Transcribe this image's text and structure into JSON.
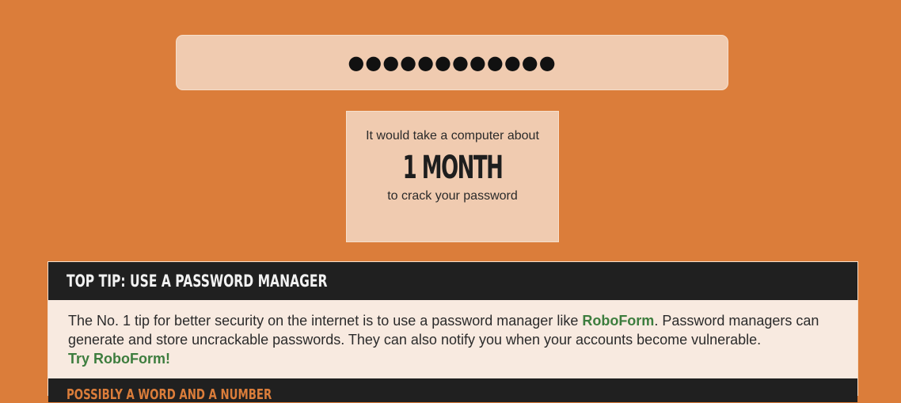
{
  "password": {
    "value": "●●●●●●●●●●●●",
    "masked": true
  },
  "result": {
    "prefix": "It would take a computer about",
    "time": "1 MONTH",
    "suffix": "to crack your password"
  },
  "tip": {
    "title": "TOP TIP: USE A PASSWORD MANAGER",
    "text_before_link": "The No. 1 tip for better security on the internet is to use a password manager like ",
    "link_label": "RoboForm",
    "text_after_link": ". Password managers can generate and store uncrackable passwords. They can also notify you when your accounts become vulnerable.",
    "try_label": "Try RoboForm!"
  },
  "next_tip": {
    "title": "POSSIBLY A WORD AND A NUMBER"
  },
  "colors": {
    "background": "#db7d3a",
    "panel": "#f0cbb0",
    "header": "#202020",
    "link": "#3d7d3e"
  }
}
